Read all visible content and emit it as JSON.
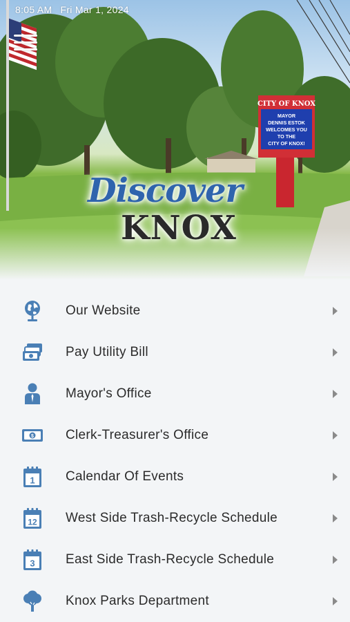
{
  "status_bar": {
    "time": "8:05 AM",
    "date": "Fri Mar 1, 2024"
  },
  "hero": {
    "logo_line1": "Discover",
    "logo_line2": "KNOX",
    "sign": {
      "header": "CITY OF KNOX",
      "lines": [
        "MAYOR",
        "DENNIS ESTOK",
        "WELCOMES YOU",
        "TO THE",
        "CITY OF KNOX!"
      ]
    }
  },
  "menu": [
    {
      "label": "Our Website",
      "icon": "globe-icon"
    },
    {
      "label": "Pay Utility Bill",
      "icon": "money-stack-icon"
    },
    {
      "label": "Mayor's Office",
      "icon": "person-icon"
    },
    {
      "label": "Clerk-Treasurer's Office",
      "icon": "banknote-icon"
    },
    {
      "label": "Calendar Of Events",
      "icon": "calendar-1-icon"
    },
    {
      "label": "West Side Trash-Recycle Schedule",
      "icon": "calendar-12-icon"
    },
    {
      "label": "East Side Trash-Recycle Schedule",
      "icon": "calendar-3-icon"
    },
    {
      "label": "Knox Parks Department",
      "icon": "tree-icon"
    }
  ],
  "colors": {
    "icon": "#4a7fb5",
    "text": "#2b2b2b",
    "chevron": "#8a8a8a",
    "list_bg": "#f3f5f7",
    "logo_blue": "#2f64ad"
  }
}
